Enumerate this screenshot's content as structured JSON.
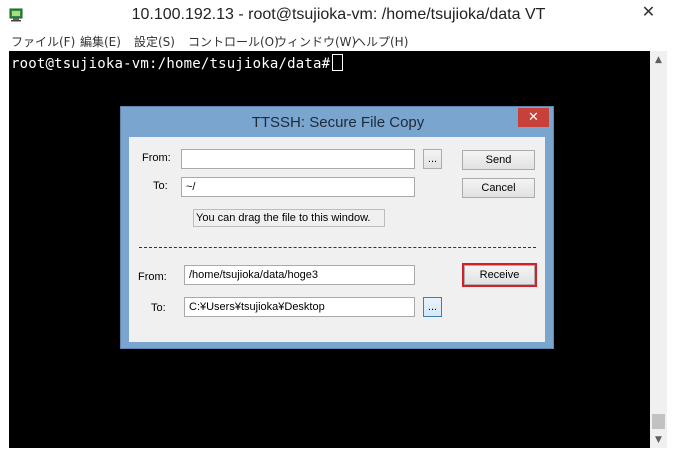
{
  "window": {
    "title": "10.100.192.13 - root@tsujioka-vm: /home/tsujioka/data VT",
    "close_symbol": "✕"
  },
  "menu": {
    "items": [
      {
        "label": "ファイル(F)"
      },
      {
        "label": "編集(E)"
      },
      {
        "label": "設定(S)"
      },
      {
        "label": "コントロール(O)"
      },
      {
        "label": "ウィンドウ(W)"
      },
      {
        "label": "ヘルプ(H)"
      }
    ]
  },
  "terminal": {
    "prompt": "root@tsujioka-vm:/home/tsujioka/data#"
  },
  "dialog": {
    "title": "TTSSH: Secure File Copy",
    "close_symbol": "✕",
    "send_section": {
      "from_label": "From:",
      "from_value": "",
      "to_label": "To:",
      "to_value": "~/",
      "browse_label": "...",
      "send_button": "Send",
      "cancel_button": "Cancel",
      "hint": "You can drag the file to this window."
    },
    "receive_section": {
      "from_label": "From:",
      "from_value": "/home/tsujioka/data/hoge3",
      "to_label": "To:",
      "to_value": "C:¥Users¥tsujioka¥Desktop",
      "browse_label": "...",
      "receive_button": "Receive"
    }
  },
  "colors": {
    "dialog_frame": "#7aa5cf",
    "dialog_close": "#c7403a",
    "highlight": "#d2202a",
    "terminal_bg": "#000000"
  }
}
